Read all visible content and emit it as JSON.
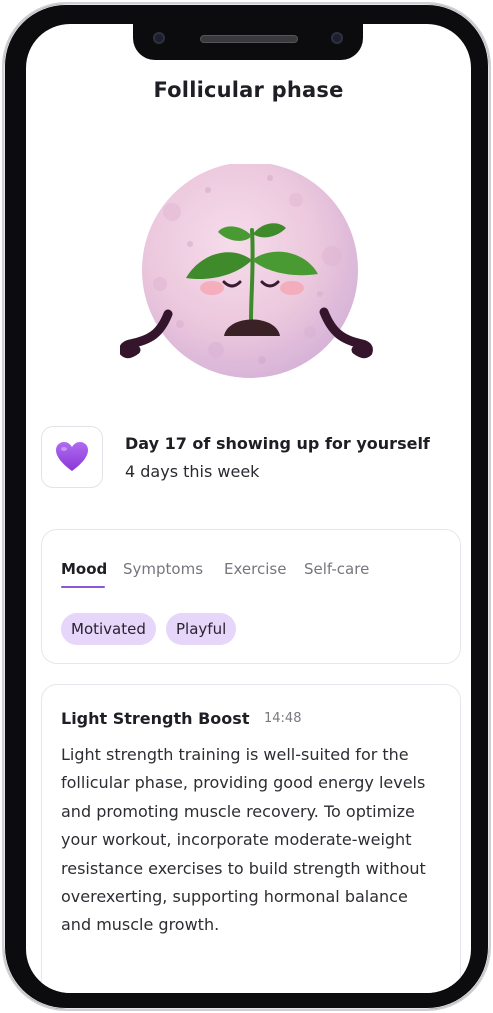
{
  "header": {
    "title": "Follicular phase"
  },
  "mascot": {
    "icon": "moon-sprout-mascot",
    "colors": {
      "moon": "#f0d6ea",
      "moon_shade": "#d8b8d6",
      "leaf": "#3f8a2b",
      "soil": "#3a2126",
      "arms": "#35152b",
      "cheeks": "#f5a3b0"
    }
  },
  "streak": {
    "icon": "purple-heart-icon",
    "title": "Day 17 of showing up for yourself",
    "subtitle": "4 days this week"
  },
  "tracker": {
    "tabs": [
      {
        "label": "Mood",
        "active": true
      },
      {
        "label": "Symptoms",
        "active": false
      },
      {
        "label": "Exercise",
        "active": false
      },
      {
        "label": "Self-care",
        "active": false
      }
    ],
    "chips": [
      "Motivated",
      "Playful"
    ],
    "accent": "#8a55d6",
    "chip_color": "#e5d6fa"
  },
  "advice": {
    "title": "Light Strength Boost",
    "time": "14:48",
    "body": "Light strength training is well-suited for the follicular phase, providing good energy levels and promoting muscle recovery. To optimize your workout, incorporate moderate-weight resistance exercises to build strength without overexerting, supporting hormonal balance and muscle growth."
  }
}
